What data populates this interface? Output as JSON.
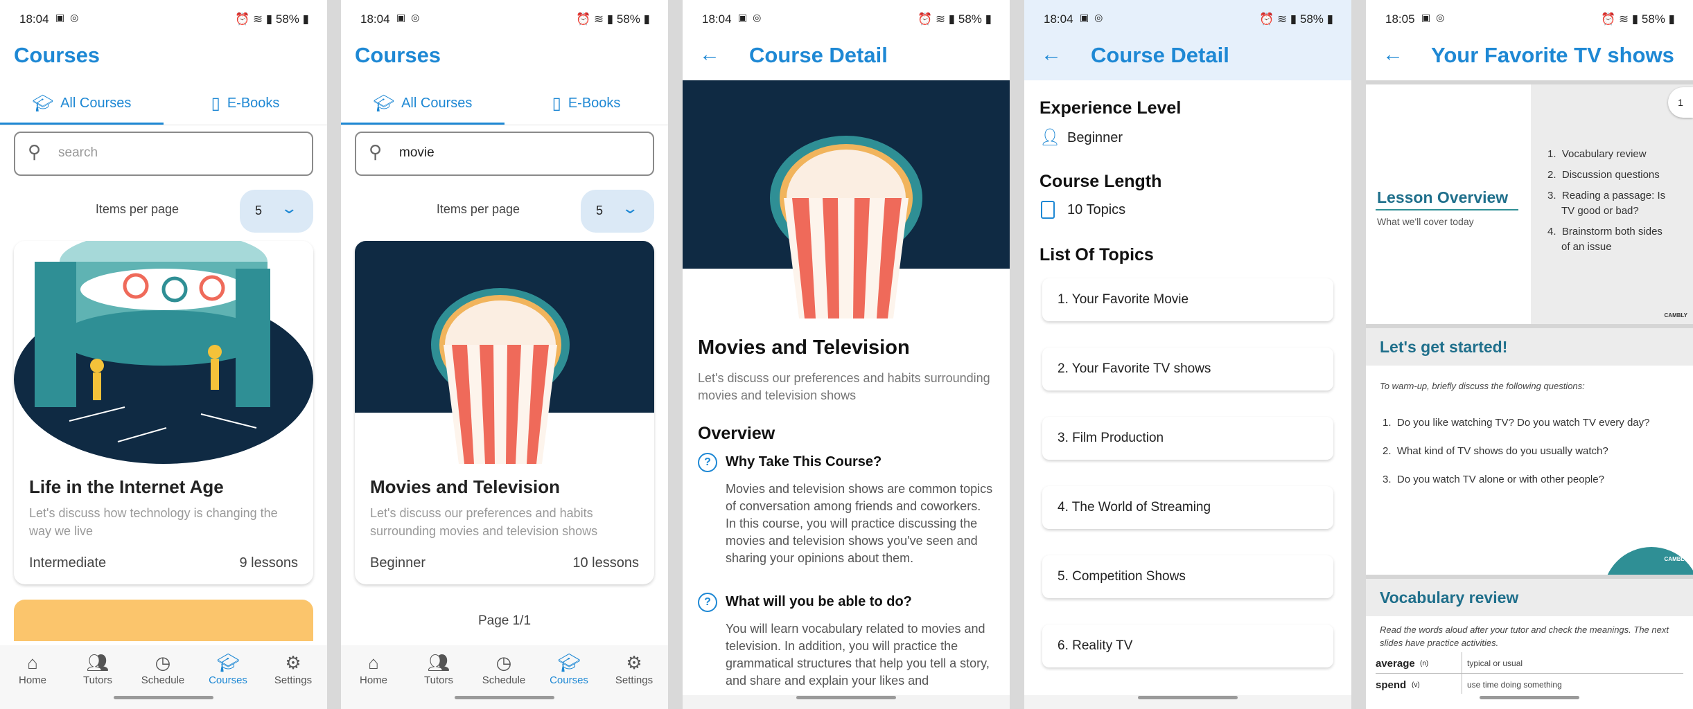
{
  "colors": {
    "accent": "#1e88d4",
    "dark_navy": "#0f2a43",
    "card_yellow": "#fbc56c",
    "popcorn_red": "#ef6a5a",
    "popcorn_teal": "#2f8f95"
  },
  "screen1": {
    "status": {
      "time": "18:04",
      "battery": "58%"
    },
    "title": "Courses",
    "tabs": [
      {
        "label": "All Courses",
        "icon": "graduation-cap-icon"
      },
      {
        "label": "E-Books",
        "icon": "book-icon"
      }
    ],
    "search": {
      "placeholder": "search",
      "value": ""
    },
    "items_per_page_label": "Items per page",
    "items_per_page_value": "5",
    "course": {
      "title": "Life in the Internet Age",
      "description": "Let's discuss how technology is changing the way we live",
      "level": "Intermediate",
      "lessons": "9 lessons"
    },
    "nav": [
      {
        "label": "Home",
        "icon": "home-icon"
      },
      {
        "label": "Tutors",
        "icon": "people-icon"
      },
      {
        "label": "Schedule",
        "icon": "clock-icon"
      },
      {
        "label": "Courses",
        "icon": "graduation-cap-icon"
      },
      {
        "label": "Settings",
        "icon": "gear-icon"
      }
    ]
  },
  "screen2": {
    "status": {
      "time": "18:04",
      "battery": "58%"
    },
    "title": "Courses",
    "tabs": [
      {
        "label": "All Courses"
      },
      {
        "label": "E-Books"
      }
    ],
    "search": {
      "value": "movie"
    },
    "items_per_page_label": "Items per page",
    "items_per_page_value": "5",
    "course": {
      "title": "Movies and Television",
      "description": "Let's discuss our preferences and habits surrounding movies and television shows",
      "level": "Beginner",
      "lessons": "10 lessons"
    },
    "page_indicator": "Page 1/1",
    "nav": [
      {
        "label": "Home"
      },
      {
        "label": "Tutors"
      },
      {
        "label": "Schedule"
      },
      {
        "label": "Courses"
      },
      {
        "label": "Settings"
      }
    ]
  },
  "screen3": {
    "status": {
      "time": "18:04",
      "battery": "58%"
    },
    "title": "Course Detail",
    "course_title": "Movies and Television",
    "course_description": "Let's discuss our preferences and habits surrounding movies and television shows",
    "overview_heading": "Overview",
    "q1": "Why Take This Course?",
    "a1": "Movies and television shows are common topics of conversation among friends and coworkers. In this course, you will practice discussing the movies and television shows you've seen and sharing your opinions about them.",
    "q2": "What will you be able to do?",
    "a2": "You will learn vocabulary related to movies and television.  In addition, you will practice the grammatical structures that help you tell a story, and share and explain your likes and"
  },
  "screen4": {
    "status": {
      "time": "18:04",
      "battery": "58%"
    },
    "title": "Course Detail",
    "experience_heading": "Experience Level",
    "experience_value": "Beginner",
    "length_heading": "Course Length",
    "length_value": "10 Topics",
    "topics_heading": "List Of Topics",
    "topics": [
      "1. Your Favorite Movie",
      "2. Your Favorite TV shows",
      "3. Film Production",
      "4. The World of Streaming",
      "5. Competition Shows",
      "6. Reality TV"
    ]
  },
  "screen5": {
    "status": {
      "time": "18:05",
      "battery": "58%"
    },
    "title": "Your Favorite TV shows",
    "page_badge": "1",
    "slide1": {
      "heading": "Lesson Overview",
      "sub": "What we'll cover today",
      "items": [
        "Vocabulary review",
        "Discussion questions",
        "Reading a passage: Is TV good or bad?",
        "Brainstorm both sides of an issue"
      ],
      "brand": "CAMBLY"
    },
    "slide2": {
      "heading": "Let's get started!",
      "intro": "To warm-up, briefly discuss the following questions:",
      "items": [
        "Do you like watching TV? Do you watch TV every day?",
        "What kind of TV shows do you usually watch?",
        "Do you watch TV alone or with other people?"
      ],
      "brand": "CAMBLY"
    },
    "slide3": {
      "heading": "Vocabulary review",
      "intro": "Read the words aloud after your tutor and check the meanings. The next slides have practice activities.",
      "rows": [
        {
          "word": "average",
          "pos": "(n)",
          "meaning": "typical or usual"
        },
        {
          "word": "spend",
          "pos": "(v)",
          "meaning": "use time doing something"
        }
      ]
    }
  }
}
